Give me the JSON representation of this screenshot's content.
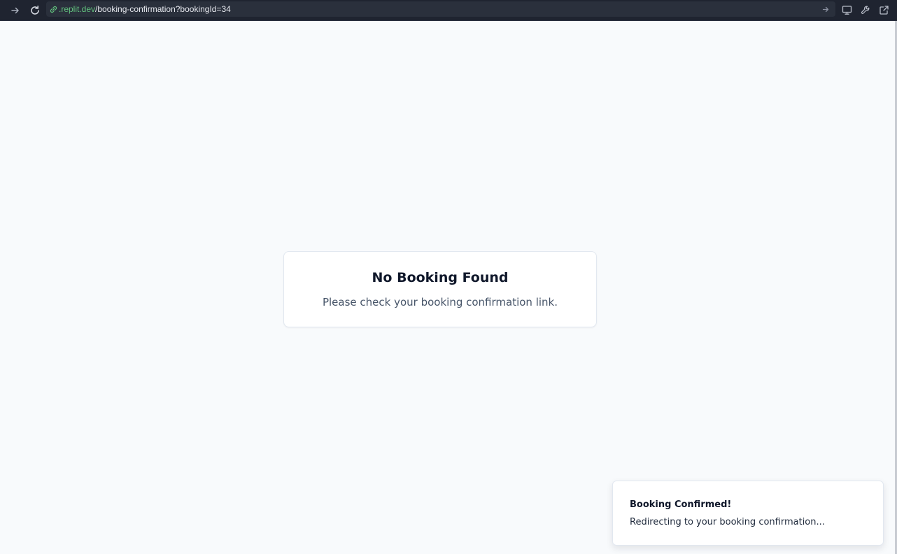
{
  "browser": {
    "url_domain": ".replit.dev",
    "url_path": "/booking-confirmation?bookingId=34",
    "icons": {
      "forward": "arrow-right-icon",
      "reload": "reload-icon",
      "link": "link-icon",
      "go": "arrow-right-icon",
      "device": "monitor-icon",
      "devtools": "wrench-icon",
      "open_external": "external-link-icon"
    }
  },
  "main": {
    "card": {
      "title": "No Booking Found",
      "message": "Please check your booking confirmation link."
    }
  },
  "toast": {
    "title": "Booking Confirmed!",
    "description": "Redirecting to your booking confirmation..."
  },
  "colors": {
    "page_background": "#f8fafc",
    "browser_bar": "#1f2430",
    "url_domain": "#62c27e"
  }
}
